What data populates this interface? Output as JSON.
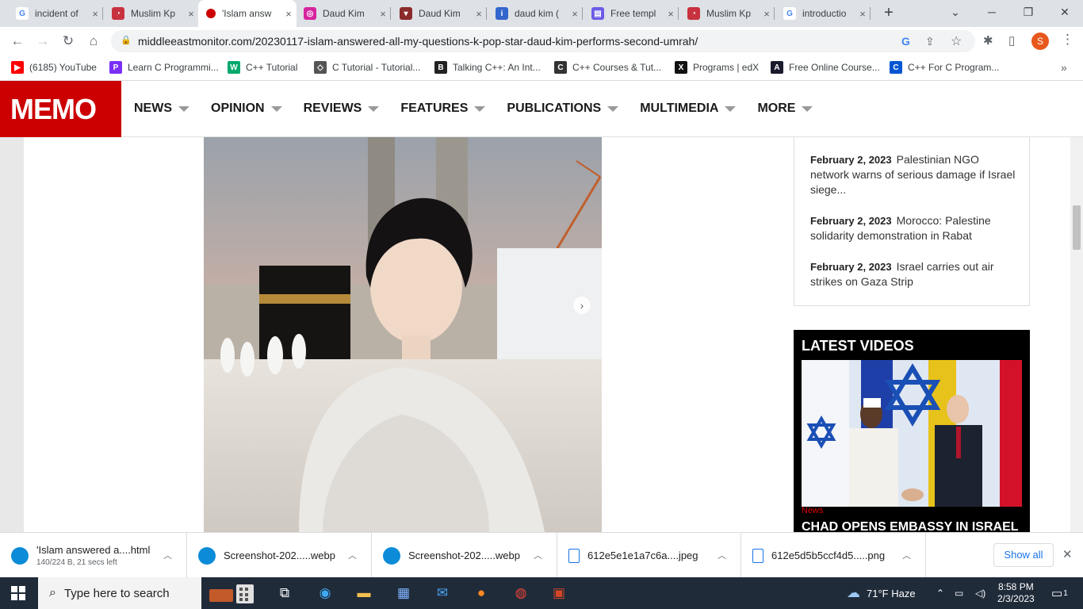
{
  "tabs": [
    {
      "title": "incident of",
      "icon": "google-icon",
      "color": "#ffffff",
      "fg": "#4285f4",
      "glyph": "G"
    },
    {
      "title": "Muslim Kp",
      "icon": "quora-icon",
      "color": "#c8323e",
      "fg": "#ffffff",
      "glyph": "◔"
    },
    {
      "title": "'Islam answ",
      "icon": "memo-icon",
      "color": "#cc0000",
      "fg": "#ffffff",
      "glyph": ""
    },
    {
      "title": "Daud Kim",
      "icon": "instagram-icon",
      "color": "#d6249f",
      "fg": "#ffffff",
      "glyph": "◎"
    },
    {
      "title": "Daud Kim",
      "icon": "wattpad-icon",
      "color": "#8b2b2b",
      "fg": "#ffffff",
      "glyph": "▾"
    },
    {
      "title": "daud kim (",
      "icon": "wiki-icon",
      "color": "#3366cc",
      "fg": "#ffffff",
      "glyph": "i"
    },
    {
      "title": "Free templ",
      "icon": "canva-icon",
      "color": "#6c5ce7",
      "fg": "#ffffff",
      "glyph": "▤"
    },
    {
      "title": "Muslim Kp",
      "icon": "quora-icon",
      "color": "#c8323e",
      "fg": "#ffffff",
      "glyph": "◔"
    },
    {
      "title": "introductio",
      "icon": "google-icon",
      "color": "#ffffff",
      "fg": "#4285f4",
      "glyph": "G"
    }
  ],
  "tab_close": "×",
  "new_tab": "+",
  "window": {
    "minimize": "─",
    "restore": "❐",
    "close": "✕",
    "tab_search": "⌄"
  },
  "toolbar": {
    "back": "←",
    "forward": "→",
    "reload": "↻",
    "home": "⌂",
    "lock": "🔒",
    "url": "middleeastmonitor.com/20230117-islam-answered-all-my-questions-k-pop-star-daud-kim-performs-second-umrah/",
    "google": "G",
    "share": "⇪",
    "star": "☆",
    "extensions": "✱",
    "sidepanel": "▯",
    "profile": "S",
    "menu": "⋮"
  },
  "bookmarks": [
    {
      "label": "(6185) YouTube",
      "icon": "youtube-icon",
      "color": "#ff0000",
      "glyph": "▶"
    },
    {
      "label": "Learn C Programmi...",
      "icon": "programiz-icon",
      "color": "#7b2ff7",
      "glyph": "P"
    },
    {
      "label": "C++ Tutorial",
      "icon": "w3schools-icon",
      "color": "#04aa6d",
      "glyph": "W"
    },
    {
      "label": "C Tutorial - Tutorial...",
      "icon": "tutorialspoint-icon",
      "color": "#555555",
      "glyph": "◇"
    },
    {
      "label": "Talking C++: An Int...",
      "icon": "bookmark-icon",
      "color": "#222222",
      "glyph": "B"
    },
    {
      "label": "C++ Courses & Tut...",
      "icon": "codecademy-icon",
      "color": "#333333",
      "glyph": "C"
    },
    {
      "label": "Programs | edX",
      "icon": "edx-icon",
      "color": "#111111",
      "glyph": "X"
    },
    {
      "label": "Free Online Course...",
      "icon": "alison-icon",
      "color": "#1a1a2e",
      "glyph": "A"
    },
    {
      "label": "C++ For C Program...",
      "icon": "coursera-icon",
      "color": "#0056d2",
      "glyph": "C"
    }
  ],
  "bookmarks_more": "»",
  "site": {
    "logo": "MEMO",
    "nav": [
      "NEWS",
      "OPINION",
      "REVIEWS",
      "FEATURES",
      "PUBLICATIONS",
      "MULTIMEDIA",
      "MORE"
    ]
  },
  "news": [
    {
      "date": "February 2, 2023",
      "text": "Palestinian NGO network warns of serious damage if Israel siege..."
    },
    {
      "date": "February 2, 2023",
      "text": "Morocco: Palestine solidarity demonstration in Rabat"
    },
    {
      "date": "February 2, 2023",
      "text": "Israel carries out air strikes on Gaza Strip"
    }
  ],
  "videos": {
    "heading": "LATEST VIDEOS",
    "category": "News",
    "title": "CHAD OPENS EMBASSY IN ISRAEL"
  },
  "slider_next": "›",
  "downloads": [
    {
      "name": "'Islam answered a....html",
      "sub": "140/224 B, 21 secs left",
      "icon": "edge-icon",
      "color": "#0c8cd8"
    },
    {
      "name": "Screenshot-202.....webp",
      "sub": "",
      "icon": "edge-icon",
      "color": "#0c8cd8"
    },
    {
      "name": "Screenshot-202.....webp",
      "sub": "",
      "icon": "edge-icon",
      "color": "#0c8cd8"
    },
    {
      "name": "612e5e1e1a7c6a....jpeg",
      "sub": "",
      "icon": "file-icon",
      "color": "#1a73e8"
    },
    {
      "name": "612e5d5b5ccf4d5.....png",
      "sub": "",
      "icon": "file-icon",
      "color": "#1a73e8"
    }
  ],
  "downloads_show_all": "Show all",
  "downloads_close": "✕",
  "taskbar": {
    "search_placeholder": "Type here to search",
    "weather": "71°F  Haze",
    "time": "8:58 PM",
    "date": "2/3/2023",
    "notifications": "1"
  }
}
